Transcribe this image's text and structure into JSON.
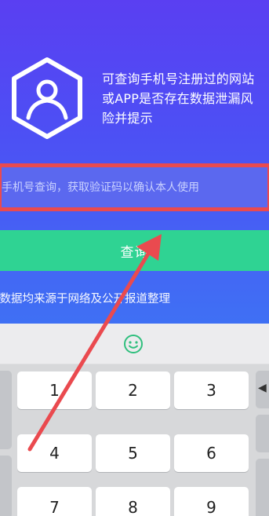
{
  "hero": {
    "description": "可查询手机号注册过的网站或APP是否存在数据泄漏风险并提示"
  },
  "search": {
    "placeholder": "入手机号查询，获取验证码以确认本人使用",
    "value": ""
  },
  "query_button": {
    "label": "查询"
  },
  "source_note": "询数据均来源于网络及公开报道整理",
  "keyboard": {
    "keys": [
      "1",
      "2",
      "3",
      "4",
      "5",
      "6",
      "7",
      "8",
      "9"
    ]
  },
  "colors": {
    "hero_top": "#5a3ff2",
    "hero_bottom": "#3f70f4",
    "button": "#2fd393",
    "highlight": "#ea4a4f",
    "annotation_arrow": "#ea4a4f"
  },
  "icons": [
    "hexagon-user-logo-icon",
    "emoji-smiley-icon",
    "annotation-arrow"
  ]
}
